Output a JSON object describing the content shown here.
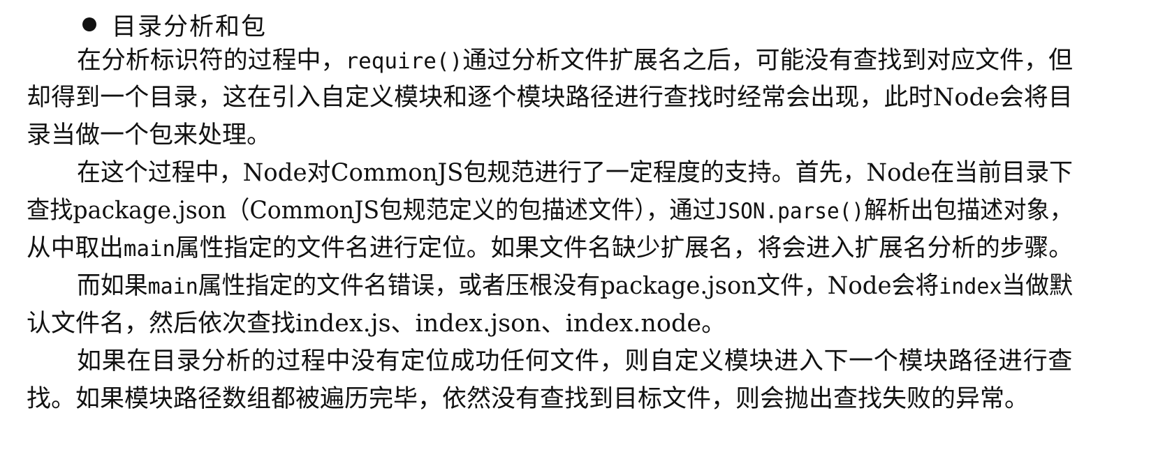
{
  "section": {
    "bullet_icon": "bullet-dot",
    "title": "目录分析和包"
  },
  "paragraphs": [
    {
      "lines": [
        [
          {
            "t": "在分析标识符的过程中，"
          },
          {
            "t": "require()",
            "code": true
          },
          {
            "t": "通过分析文件扩展名之后，可能没有查找到对应文件，但"
          }
        ],
        [
          {
            "t": "却得到一个目录，这在引入自定义模块和逐个模块路径进行查找时经常会出现，此时Node会将目"
          }
        ],
        [
          {
            "t": "录当做一个包来处理。"
          }
        ]
      ]
    },
    {
      "lines": [
        [
          {
            "t": "在这个过程中，Node对CommonJS包规范进行了一定程度的支持。首先，Node在当前目录下"
          }
        ],
        [
          {
            "t": "查找package.json（CommonJS包规范定义的包描述文件），通过"
          },
          {
            "t": "JSON.parse()",
            "code": true
          },
          {
            "t": "解析出包描述对象，"
          }
        ],
        [
          {
            "t": "从中取出"
          },
          {
            "t": "main",
            "code": true
          },
          {
            "t": "属性指定的文件名进行定位。如果文件名缺少扩展名，将会进入扩展名分析的步骤。"
          }
        ]
      ]
    },
    {
      "lines": [
        [
          {
            "t": "而如果"
          },
          {
            "t": "main",
            "code": true
          },
          {
            "t": "属性指定的文件名错误，或者压根没有package.json文件，Node会将"
          },
          {
            "t": "index",
            "code": true
          },
          {
            "t": "当做默"
          }
        ],
        [
          {
            "t": "认文件名，然后依次查找index.js、index.json、index.node。"
          }
        ]
      ]
    },
    {
      "lines": [
        [
          {
            "t": "如果在目录分析的过程中没有定位成功任何文件，则自定义模块进入下一个模块路径进行查"
          }
        ],
        [
          {
            "t": "找。如果模块路径数组都被遍历完毕，依然没有查找到目标文件，则会抛出查找失败的异常。"
          }
        ]
      ]
    }
  ]
}
